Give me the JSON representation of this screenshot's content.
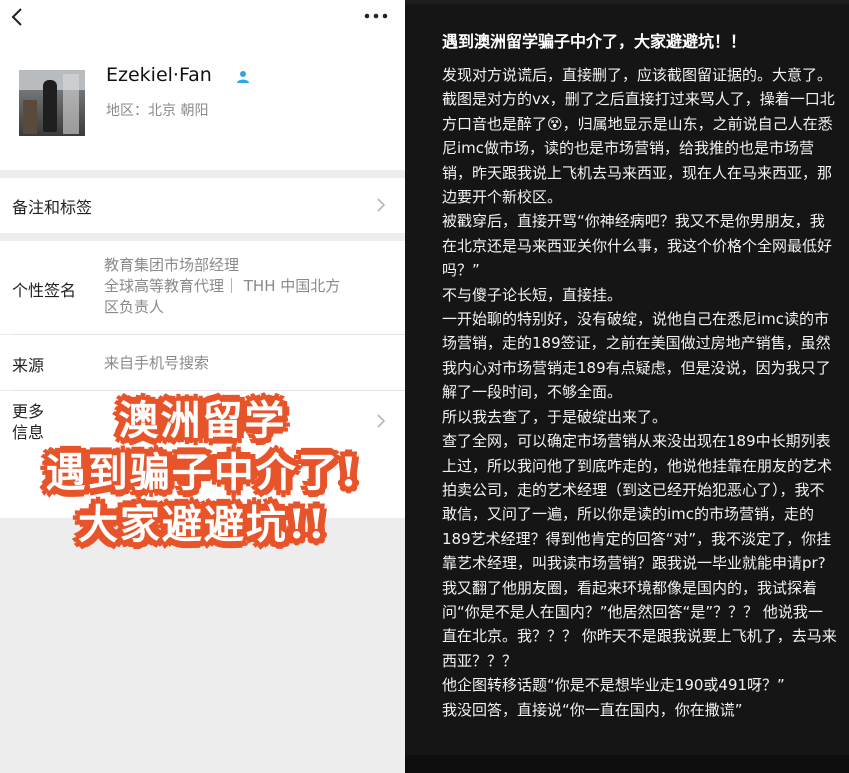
{
  "left": {
    "profile": {
      "name": "Ezekiel·Fan",
      "region": "地区：北京 朝阳"
    },
    "rows": {
      "notes_label": "备注和标签",
      "signature_label": "个性签名",
      "signature_line1": "教育集团市场部经理",
      "signature_line2": "全球高等教育代理｜ THH 中国北方",
      "signature_line3": "区负责人",
      "source_label": "来源",
      "source_value": "来自手机号搜索",
      "more_label_1": "更多",
      "more_label_2": "信息"
    },
    "sticker": {
      "line1": "澳洲留学",
      "line2": "遇到骗子中介了!",
      "line3": "大家避避坑!!"
    },
    "icons": {
      "back": "back-chevron-icon",
      "more": "more-dots-icon",
      "person": "person-icon",
      "chevron": "chevron-right-icon"
    },
    "colors": {
      "sticker_outline": "#e8542a",
      "person_icon": "#2aa8e6"
    }
  },
  "right": {
    "title": "遇到澳洲留学骗子中介了，大家避避坑！！",
    "paragraphs": [
      "发现对方说谎后，直接删了，应该截图留证据的。大意了。",
      "截图是对方的vx，删了之后直接打过来骂人了，操着一口北方口音也是醉了😵，归属地显示是山东，之前说自己人在悉尼imc做市场，读的也是市场营销，给我推的也是市场营销，昨天跟我说上飞机去马来西亚，现在人在马来西亚，那边要开个新校区。",
      "被戳穿后，直接开骂“你神经病吧？我又不是你男朋友，我在北京还是马来西亚关你什么事，我这个价格个全网最低好吗？”",
      "不与傻子论长短，直接挂。",
      "一开始聊的特别好，没有破绽，说他自己在悉尼imc读的市场营销，走的189签证，之前在美国做过房地产销售，虽然我内心对市场营销走189有点疑虑，但是没说，因为我只了解了一段时间，不够全面。",
      "所以我去查了，于是破绽出来了。",
      "查了全网，可以确定市场营销从来没出现在189中长期列表上过，所以我问他了到底咋走的，他说他挂靠在朋友的艺术拍卖公司，走的艺术经理（到这已经开始犯恶心了），我不敢信，又问了一遍，所以你是读的imc的市场营销，走的189艺术经理？得到他肯定的回答“对”，我不淡定了，你挂靠艺术经理，叫我读市场营销？跟我说一毕业就能申请pr?",
      "我又翻了他朋友圈，看起来环境都像是国内的，我试探着问“你是不是人在国内？”他居然回答“是”？？？ 他说我一直在北京。我？？？ 你昨天不是跟我说要上飞机了，去马来西亚？？？",
      "他企图转移话题“你是不是想毕业走190或491呀？”",
      "我没回答，直接说“你一直在国内，你在撒谎”"
    ]
  }
}
